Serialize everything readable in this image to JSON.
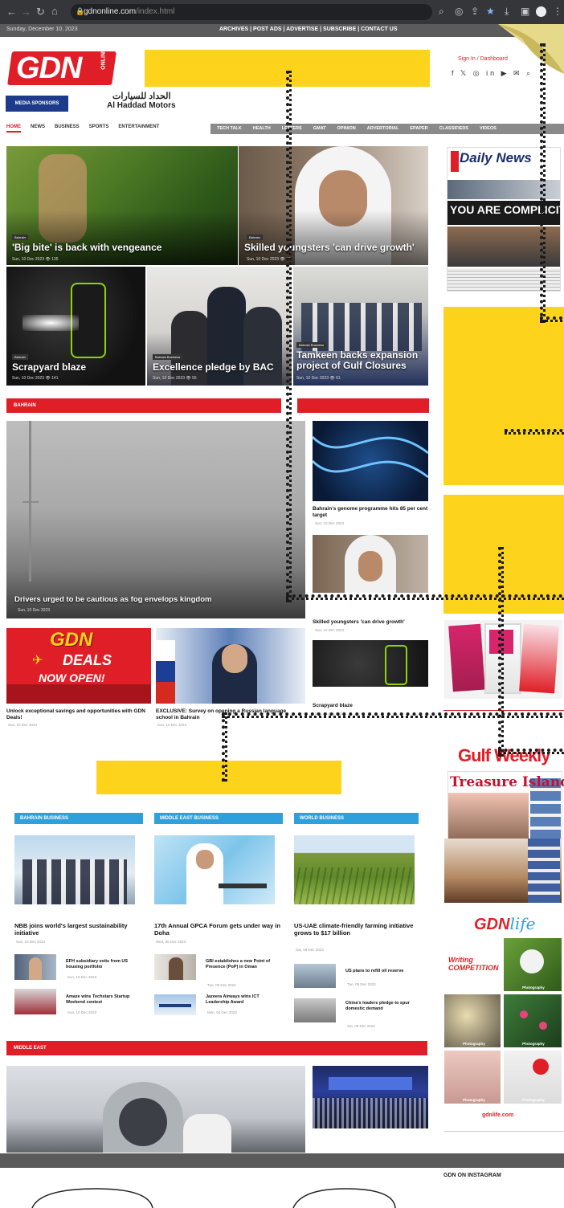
{
  "browser": {
    "url_host": "gdnonline.com",
    "url_path": "/index.html"
  },
  "topbar": {
    "date": "Sunday, December 10, 2023",
    "links": "ARCHIVES | POST ADS | ADVERTISE | SUBSCRIBE | CONTACT US"
  },
  "header": {
    "logo": "GDN",
    "logo_sub": "ONLINE",
    "signin": "Sign In / Dashboard",
    "socials": "f 𝕏 ◎ in ▶ ✉ ⌕",
    "sponsor": "MEDIA SPONSORS",
    "sponsor_brand_ar": "الحداد للسيارات",
    "sponsor_brand_en": "Al Haddad Motors"
  },
  "nav": {
    "left": [
      "HOME",
      "NEWS",
      "BUSINESS",
      "SPORTS",
      "ENTERTAINMENT"
    ],
    "right": [
      "TECH TALK",
      "HEALTH",
      "LETTERS",
      "GMAT",
      "OPINION",
      "ADVERTORIAL",
      "EPAPER",
      "CLASSIFIEDS",
      "VIDEOS"
    ]
  },
  "hero": [
    {
      "tag": "Bahrain",
      "title": "'Big bite' is back with vengeance",
      "meta": "Sun, 10 Dec 2023  👁 135"
    },
    {
      "tag": "Bahrain",
      "title": "Skilled youngsters 'can drive growth'",
      "meta": "Sun, 10 Dec 2023  👁 96"
    },
    {
      "tag": "Bahrain",
      "title": "Scrapyard blaze",
      "meta": "Sun, 10 Dec 2023  👁 141"
    },
    {
      "tag": "Bahrain Business",
      "title": "Excellence pledge by BAC",
      "meta": "Sun, 10 Dec 2023  👁 55"
    },
    {
      "tag": "Bahrain Business",
      "title": "Tamkeen backs expansion project of Gulf Closures",
      "meta": "Sun, 10 Dec 2023  👁 61"
    }
  ],
  "bahrain_section": {
    "label": "BAHRAIN",
    "main_title": "Drivers urged to be cautious as fog envelops kingdom",
    "main_meta": "Sun, 10 Dec 2023",
    "side": [
      {
        "title": "Bahrain's genome programme hits 85 per cent target",
        "meta": "Sun, 10 Dec 2023"
      },
      {
        "title": "Skilled youngsters 'can drive growth'",
        "meta": "Sun, 10 Dec 2023"
      },
      {
        "title": "Scrapyard blaze",
        "meta": "Sun, 10 Dec 2023"
      }
    ],
    "deals": {
      "line1": "GDN",
      "line2": "DEALS",
      "line3": "NOW OPEN!"
    },
    "bottom": [
      {
        "title": "Unlock exceptional savings and opportunities with GDN Deals!",
        "meta": "Sun, 10 Dec 2023"
      },
      {
        "title": "EXCLUSIVE: Survey on opening a Russian language school in Bahrain",
        "meta": "Sun, 10 Dec 2023"
      }
    ]
  },
  "business": {
    "cols": [
      {
        "label": "BAHRAIN BUSINESS",
        "lead_title": "NBB joins world's largest sustainability initiative",
        "lead_meta": "Sun, 10 Dec 2023",
        "items": [
          {
            "title": "EFH subsidiary exits from US housing portfolio",
            "meta": "Sun, 10 Dec 2023"
          },
          {
            "title": "Amaze wins Techstars Startup Weekend contest",
            "meta": "Sun, 10 Dec 2023"
          }
        ]
      },
      {
        "label": "MIDDLE EAST BUSINESS",
        "lead_title": "17th Annual GPCA Forum gets under way in Doha",
        "lead_meta": "Wed, 06 Dec 2023",
        "items": [
          {
            "title": "GBI establishes a new Point of Presence (PoP) in Oman",
            "meta": "Tue, 05 Dec 2023"
          },
          {
            "title": "Jazeera Airways wins ICT Leadership Award",
            "meta": "Mon, 04 Dec 2023"
          }
        ]
      },
      {
        "label": "WORLD BUSINESS",
        "lead_title": "US-UAE climate-friendly farming initiative grows to $17 billion",
        "lead_meta": "Sat, 09 Dec 2023",
        "items": [
          {
            "title": "US plans to refill oil reserve",
            "meta": "Tue, 05 Dec 2023"
          },
          {
            "title": "China's leaders pledge to spur domestic demand",
            "meta": "Sat, 09 Dec 2023"
          }
        ]
      }
    ]
  },
  "middle_east": {
    "label": "MIDDLE EAST"
  },
  "sidebar": {
    "daily_news": "Daily News",
    "daily_headline": "YOU ARE COMPLICIT",
    "gulf_weekly": "Gulf Weekly",
    "gulf_headline": "Treasure Island",
    "gdnlife": "GDN",
    "gdnlife_sub": "life",
    "photo_label": "Photography",
    "writing": "Writing COMPETITION",
    "gdnlife_url": "gdnlife.com",
    "instagram": "GDN ON INSTAGRAM"
  },
  "colors": {
    "brand_red": "#e01e27",
    "ad_yellow": "#fdd31b",
    "business_blue": "#2ea0db"
  }
}
